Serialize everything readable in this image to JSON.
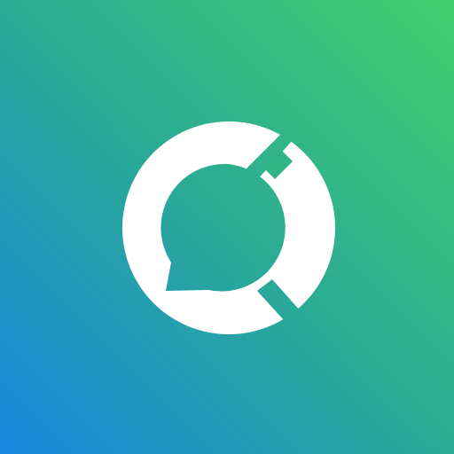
{
  "app_icon": {
    "logo_icon": "chat-bubble-ring-logo-icon",
    "colors": {
      "gradient_top_right": "#44cf6c",
      "gradient_middle": "#2aaa95",
      "gradient_bottom_left": "#1a86e0",
      "logo": "#ffffff"
    }
  }
}
